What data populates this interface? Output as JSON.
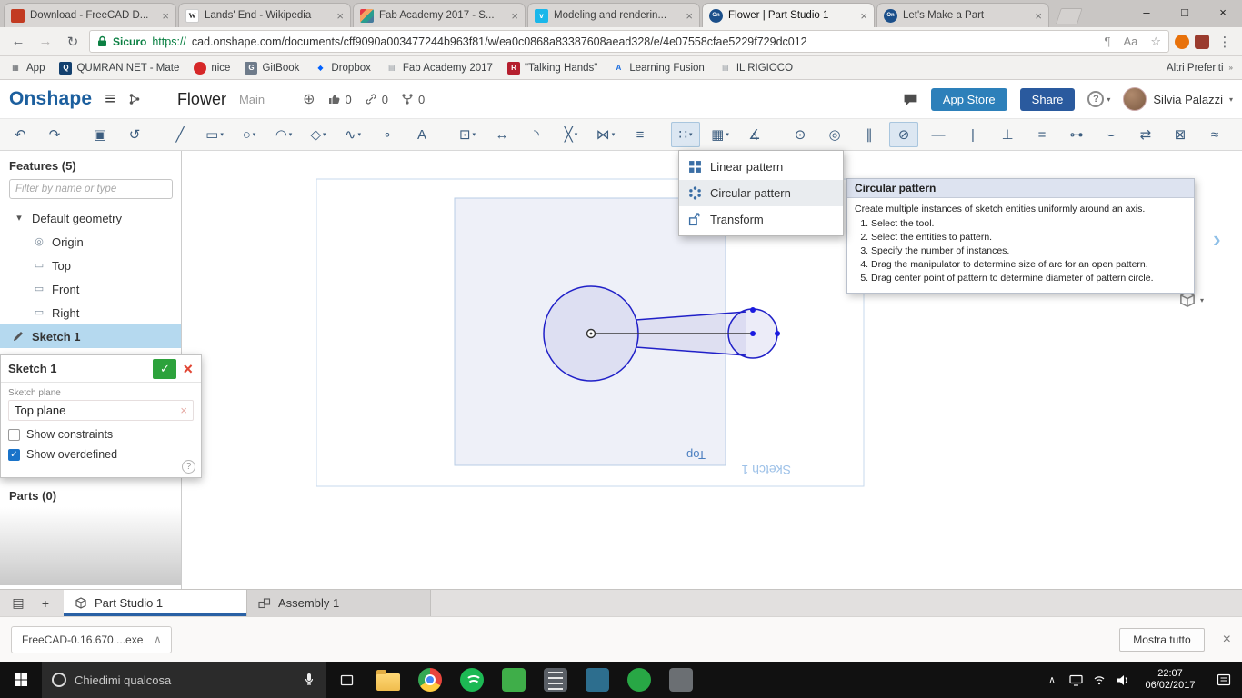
{
  "browser": {
    "window_controls": {
      "minimize": "–",
      "maximize": "□",
      "close": "×"
    },
    "tab_close_glyph": "×",
    "tabs": [
      {
        "name": "tab-download-freecad",
        "title": "Download - FreeCAD D...",
        "fav": "fav-freecad",
        "letter": ""
      },
      {
        "name": "tab-lands-end-wikipedia",
        "title": "Lands' End - Wikipedia",
        "fav": "fav-wikipedia",
        "letter": "W"
      },
      {
        "name": "tab-fab-academy",
        "title": "Fab Academy 2017 - S...",
        "fav": "fav-fab",
        "letter": ""
      },
      {
        "name": "tab-modeling-rendering",
        "title": "Modeling and renderin...",
        "fav": "fav-vimeo",
        "letter": "v"
      },
      {
        "name": "tab-flower-part-studio",
        "title": "Flower | Part Studio 1",
        "fav": "fav-onshape",
        "letter": "On",
        "active": true
      },
      {
        "name": "tab-lets-make-a-part",
        "title": "Let's Make a Part",
        "fav": "fav-onshape",
        "letter": "On"
      }
    ],
    "address": {
      "back": "←",
      "forward": "→",
      "reload": "↻",
      "secure_label": "Sicuro",
      "url_scheme": "https://",
      "url_rest": "cad.onshape.com/documents/cff9090a003477244b963f81/w/ea0c0868a83387608aead328/e/4e07558cfae5229f729dc012",
      "reader_glyph": "¶",
      "translate_glyph": "Aa",
      "star_glyph": "☆",
      "menu_glyph": "⋮"
    },
    "bookmarks": [
      {
        "name": "bookmark-apps",
        "label": "App",
        "fav": "fav-apps",
        "letter": "▦"
      },
      {
        "name": "bookmark-qumran-net",
        "label": "QUMRAN NET - Mate",
        "fav": "fav-qumran",
        "letter": "Q"
      },
      {
        "name": "bookmark-nice",
        "label": "nice",
        "fav": "fav-nice",
        "letter": ""
      },
      {
        "name": "bookmark-gitbook",
        "label": "GitBook",
        "fav": "fav-gitbook",
        "letter": "G"
      },
      {
        "name": "bookmark-dropbox",
        "label": "Dropbox",
        "fav": "fav-dropbox",
        "letter": "◆"
      },
      {
        "name": "bookmark-fab-academy-2017",
        "label": "Fab Academy 2017",
        "fav": "fav-page",
        "letter": "▤"
      },
      {
        "name": "bookmark-talking-hands",
        "label": "\"Talking Hands\"",
        "fav": "fav-r",
        "letter": "R"
      },
      {
        "name": "bookmark-learning-fusion",
        "label": "Learning Fusion",
        "fav": "fav-fusion",
        "letter": "A"
      },
      {
        "name": "bookmark-il-rigioco",
        "label": "IL RIGIOCO",
        "fav": "fav-page",
        "letter": "▤"
      }
    ],
    "bookmarks_right": "Altri Preferiti"
  },
  "onshape": {
    "logo": "Onshape",
    "hamburger_glyph": "≡",
    "doc_title": "Flower",
    "workspace": "Main",
    "globe_glyph": "⊕",
    "like_count": "0",
    "link_count": "0",
    "fork_count": "0",
    "app_store_label": "App Store",
    "share_label": "Share",
    "help_glyph": "?",
    "user_name": "Silvia Palazzi",
    "caret_glyph": "▾"
  },
  "toolbar": {
    "caret_glyph": "▾",
    "items": [
      {
        "name": "undo-icon",
        "glyph": "↶"
      },
      {
        "name": "redo-icon",
        "glyph": "↷"
      },
      {
        "name": "sketch-button",
        "glyph": "▣",
        "group_start": true
      },
      {
        "name": "use-project-icon",
        "glyph": "↺"
      },
      {
        "name": "line-tool-icon",
        "glyph": "╱",
        "group_start": true
      },
      {
        "name": "rectangle-tool-icon",
        "glyph": "▭",
        "caret": true
      },
      {
        "name": "circle-tool-icon",
        "glyph": "○",
        "caret": true
      },
      {
        "name": "arc-tool-icon",
        "glyph": "◠",
        "caret": true
      },
      {
        "name": "polygon-tool-icon",
        "glyph": "◇",
        "caret": true
      },
      {
        "name": "spline-tool-icon",
        "glyph": "∿",
        "caret": true
      },
      {
        "name": "point-tool-icon",
        "glyph": "∘"
      },
      {
        "name": "text-tool-icon",
        "glyph": "A"
      },
      {
        "name": "slot-tool-icon",
        "glyph": "⊡",
        "caret": true,
        "group_start": true
      },
      {
        "name": "dimension-tool-icon",
        "glyph": "↔"
      },
      {
        "name": "fillet-tool-icon",
        "glyph": "◝"
      },
      {
        "name": "trim-tool-icon",
        "glyph": "╳",
        "caret": true
      },
      {
        "name": "mirror-tool-icon",
        "glyph": "⋈",
        "caret": true
      },
      {
        "name": "offset-tool-icon",
        "glyph": "≡"
      },
      {
        "name": "pattern-tool-icon",
        "glyph": "∷",
        "caret": true,
        "active": true,
        "group_start": true
      },
      {
        "name": "insert-image-icon",
        "glyph": "▦",
        "caret": true
      },
      {
        "name": "measure-tool-icon",
        "glyph": "∡"
      },
      {
        "name": "coincident-constraint-icon",
        "glyph": "⊙",
        "group_start": true
      },
      {
        "name": "concentric-constraint-icon",
        "glyph": "◎"
      },
      {
        "name": "parallel-constraint-icon",
        "glyph": "∥"
      },
      {
        "name": "tangent-constraint-icon",
        "glyph": "⊘",
        "active": true
      },
      {
        "name": "horizontal-constraint-icon",
        "glyph": "―"
      },
      {
        "name": "vertical-constraint-icon",
        "glyph": "|"
      },
      {
        "name": "perpendicular-constraint-icon",
        "glyph": "⊥"
      },
      {
        "name": "equal-constraint-icon",
        "glyph": "="
      },
      {
        "name": "midpoint-constraint-icon",
        "glyph": "⊶"
      },
      {
        "name": "tangent-arc-constraint-icon",
        "glyph": "⌣"
      },
      {
        "name": "symmetric-constraint-icon",
        "glyph": "⇄"
      },
      {
        "name": "fix-constraint-icon",
        "glyph": "⊠"
      },
      {
        "name": "construction-toggle-icon",
        "glyph": "≈"
      }
    ]
  },
  "menu": {
    "items": [
      {
        "label": "Linear pattern"
      },
      {
        "label": "Circular pattern",
        "selected": true
      },
      {
        "label": "Transform"
      }
    ]
  },
  "tooltip": {
    "title": "Circular pattern",
    "intro": "Create multiple instances of sketch entities uniformly around an axis.",
    "steps": [
      "Select the tool.",
      "Select the entities to pattern.",
      "Specify the number of instances.",
      "Drag the manipulator to determine size of arc for an open pattern.",
      "Drag center point of pattern to determine diameter of pattern circle."
    ]
  },
  "features": {
    "title": "Features (5)",
    "filter_placeholder": "Filter by name or type",
    "tree": [
      "Default geometry",
      "Origin",
      "Top",
      "Front",
      "Right",
      "Sketch 1"
    ],
    "parts_label": "Parts (0)"
  },
  "sketch_dialog": {
    "title": "Sketch 1",
    "confirm_glyph": "✓",
    "cancel_glyph": "×",
    "plane_label": "Sketch plane",
    "plane_value": "Top plane",
    "remove_glyph": "×",
    "checkboxes": [
      {
        "label": "Show constraints",
        "checked": false
      },
      {
        "label": "Show overdefined",
        "checked": true
      }
    ],
    "help_glyph": "?"
  },
  "canvas": {
    "plane_label": "Top",
    "sketch_label": "Sketch 1",
    "expand_glyph": "›"
  },
  "bottom_tabs": {
    "tabs": [
      {
        "label": "Part Studio 1",
        "active": true
      },
      {
        "label": "Assembly 1"
      }
    ],
    "add_glyph": "+"
  },
  "download_bar": {
    "file_label": "FreeCAD-0.16.670....exe",
    "expand_glyph": "∧",
    "show_all_label": "Mostra tutto",
    "close_glyph": "×"
  },
  "taskbar": {
    "search_placeholder": "Chiedimi qualcosa",
    "tray_expand_glyph": "∧",
    "time": "22:07",
    "date": "06/02/2017"
  }
}
